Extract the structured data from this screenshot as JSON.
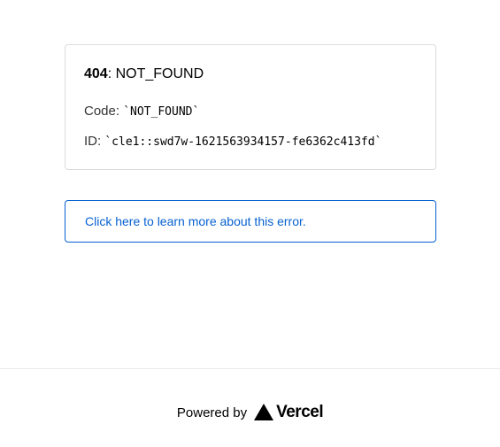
{
  "error": {
    "status_code": "404",
    "separator": ":",
    "status_text": "NOT_FOUND",
    "code_label": "Code:",
    "code_value": "`NOT_FOUND`",
    "id_label": "ID:",
    "id_value": "`cle1::swd7w-1621563934157-fe6362c413fd`"
  },
  "learn_more": {
    "label": "Click here to learn more about this error."
  },
  "footer": {
    "powered_by": "Powered by",
    "brand": "Vercel"
  },
  "colors": {
    "link": "#0761d1",
    "border": "#dcdcdc"
  },
  "icons": {
    "brand_logo": "vercel-triangle-icon"
  }
}
